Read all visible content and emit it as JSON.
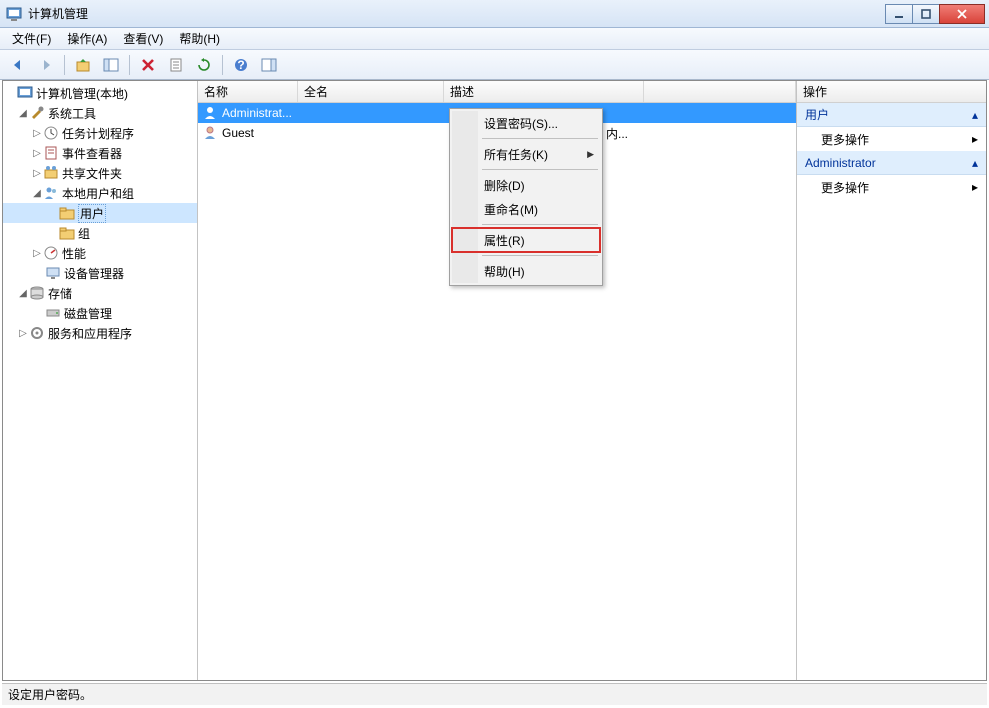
{
  "window": {
    "title": "计算机管理"
  },
  "menu": {
    "file": "文件(F)",
    "action": "操作(A)",
    "view": "查看(V)",
    "help": "帮助(H)"
  },
  "tree": {
    "root": "计算机管理(本地)",
    "n1": "系统工具",
    "n1a": "任务计划程序",
    "n1b": "事件查看器",
    "n1c": "共享文件夹",
    "n1d": "本地用户和组",
    "n1d1": "用户",
    "n1d2": "组",
    "n1e": "性能",
    "n1f": "设备管理器",
    "n2": "存储",
    "n2a": "磁盘管理",
    "n3": "服务和应用程序"
  },
  "list": {
    "cols": {
      "name": "名称",
      "fullname": "全名",
      "desc": "描述"
    },
    "rows": [
      {
        "name": "Administrat...",
        "fullname": "",
        "desc": ""
      },
      {
        "name": "Guest",
        "fullname": "",
        "desc": ""
      }
    ],
    "desc_trunc": "内..."
  },
  "ctx": {
    "setpwd": "设置密码(S)...",
    "alltasks": "所有任务(K)",
    "delete": "删除(D)",
    "rename": "重命名(M)",
    "props": "属性(R)",
    "help": "帮助(H)"
  },
  "actions": {
    "header": "操作",
    "section1": "用户",
    "more1": "更多操作",
    "section2": "Administrator",
    "more2": "更多操作"
  },
  "status": "设定用户密码。"
}
